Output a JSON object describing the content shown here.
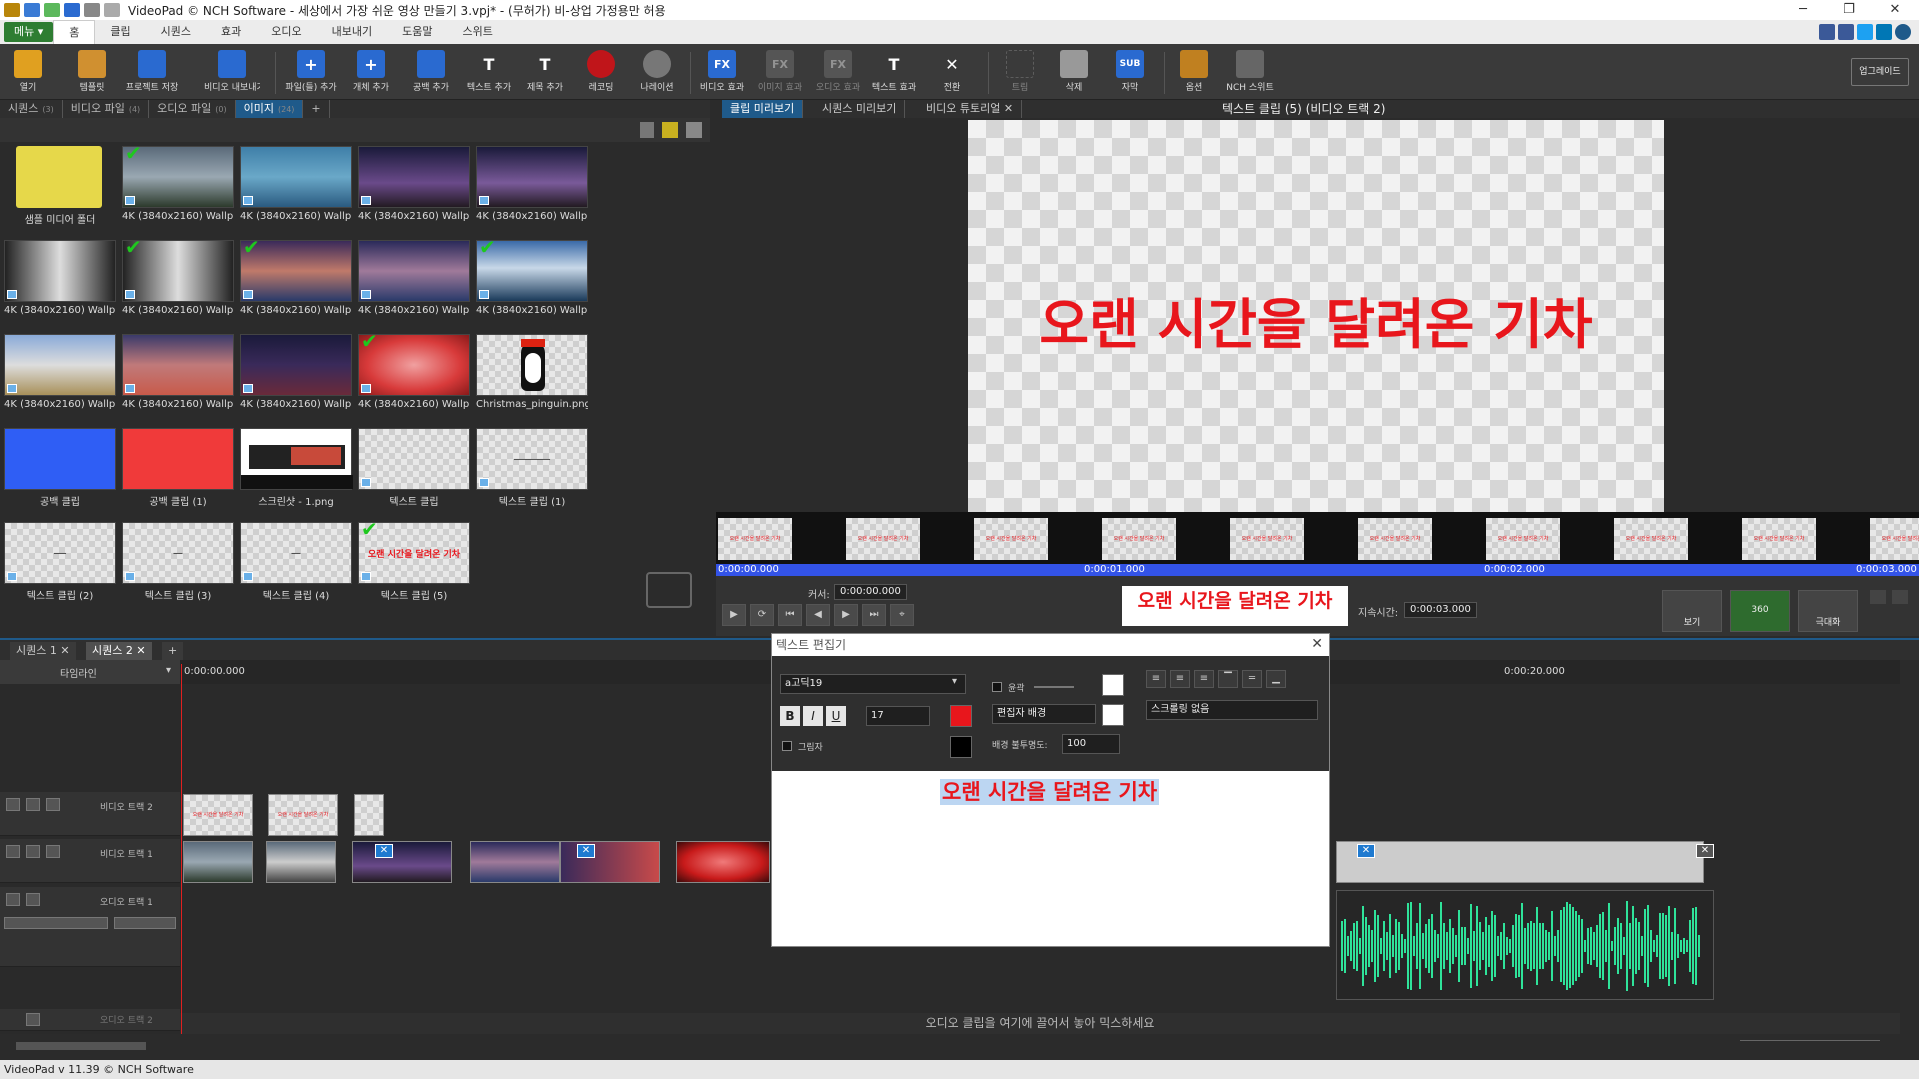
{
  "titlebar": {
    "title": "VideoPad © NCH Software - 세상에서 가장 쉬운 영상 만들기 3.vpj* - (무허가) 비-상업 가정용만 허용"
  },
  "menu": {
    "main": "메뉴 ▾",
    "items": [
      "홈",
      "클립",
      "시퀀스",
      "효과",
      "오디오",
      "내보내기",
      "도움말",
      "스위트"
    ]
  },
  "toolbar": {
    "items": [
      "열기",
      "템플릿",
      "프로젝트 저장",
      "비디오 내보내기",
      "파일(들) 추가",
      "개체 추가",
      "공백 추가",
      "텍스트 추가",
      "제목 추가",
      "레코딩",
      "나레이션",
      "비디오 효과",
      "이미지 효과",
      "오디오 효과",
      "텍스트 효과",
      "전환",
      "트림",
      "삭제",
      "자막",
      "옵션",
      "NCH 스위트"
    ],
    "upgrade": "업그레이드"
  },
  "library": {
    "tabs": [
      {
        "label": "시퀀스",
        "count": "(3)"
      },
      {
        "label": "비디오 파일",
        "count": "(4)"
      },
      {
        "label": "오디오 파일",
        "count": "(0)"
      },
      {
        "label": "이미지",
        "count": "(24)"
      }
    ],
    "add_tab": "+",
    "items": [
      "샘플 미디어 폴더",
      "4K (3840x2160) Wallp...",
      "4K (3840x2160) Wallp...",
      "4K (3840x2160) Wallp...",
      "4K (3840x2160) Wallp...",
      "4K (3840x2160) Wallp...",
      "4K (3840x2160) Wallp...",
      "4K (3840x2160) Wallp...",
      "4K (3840x2160) Wallp...",
      "4K (3840x2160) Wallp...",
      "4K (3840x2160) Wallp...",
      "4K (3840x2160) Wallp...",
      "4K (3840x2160) Wallp...",
      "4K (3840x2160) Wallp...",
      "Christmas_pinguin.png",
      "공백 클립",
      "공백 클립 (1)",
      "스크린샷 - 1.png",
      "텍스트 클립",
      "텍스트 클립 (1)",
      "텍스트 클립 (2)",
      "텍스트 클립 (3)",
      "텍스트 클립 (4)",
      "텍스트 클립 (5)"
    ],
    "clip5_text": "오랜 시간을 달려온 기차"
  },
  "preview": {
    "tabs": [
      "클립 미리보기",
      "시퀀스 미리보기",
      "비디오 튜토리얼"
    ],
    "title": "텍스트 클립 (5) (비디오 트랙 2)",
    "canvas_text": "오랜 시간을 달려온 기차",
    "ruler": [
      "0:00:00.000",
      "0:00:01.000",
      "0:00:02.000",
      "0:00:03.000"
    ],
    "cursor_label": "커서:",
    "cursor_value": "0:00:00.000",
    "duration_label": "지속시간:",
    "duration_value": "0:00:03.000",
    "view_label": "보기",
    "btn_360": "360",
    "fullscreen_label": "극대화"
  },
  "sequences": {
    "tabs": [
      "시퀀스 1",
      "시퀀스 2"
    ],
    "add": "+"
  },
  "timeline": {
    "label": "타임라인",
    "ruler": [
      "0:00:00.000",
      "0:00:20.000"
    ],
    "tracks": [
      "비디오 트랙 2",
      "비디오 트랙 1",
      "오디오 트랙 1",
      "오디오 트랙 2"
    ],
    "drop_hint": "오디오 클립을 여기에 끌어서 놓아 믹스하세요"
  },
  "dialog": {
    "title": "텍스트 편집기",
    "font": "a고딕19",
    "bold": "B",
    "italic": "I",
    "underline": "U",
    "size": "17",
    "shadow_label": "그림자",
    "outline_label": "윤곽",
    "background_mode": "편집자 배경",
    "opacity_label": "배경 불투명도:",
    "opacity_value": "100",
    "scroll_mode": "스크롤링 없음",
    "text": "오랜 시간을 달려온 기차",
    "colors": {
      "text": "#e8161c",
      "shadow": "#000000",
      "outline": "#ffffff",
      "background": "#ffffff"
    }
  },
  "statusbar": {
    "text": "VideoPad v 11.39 © NCH Software"
  }
}
